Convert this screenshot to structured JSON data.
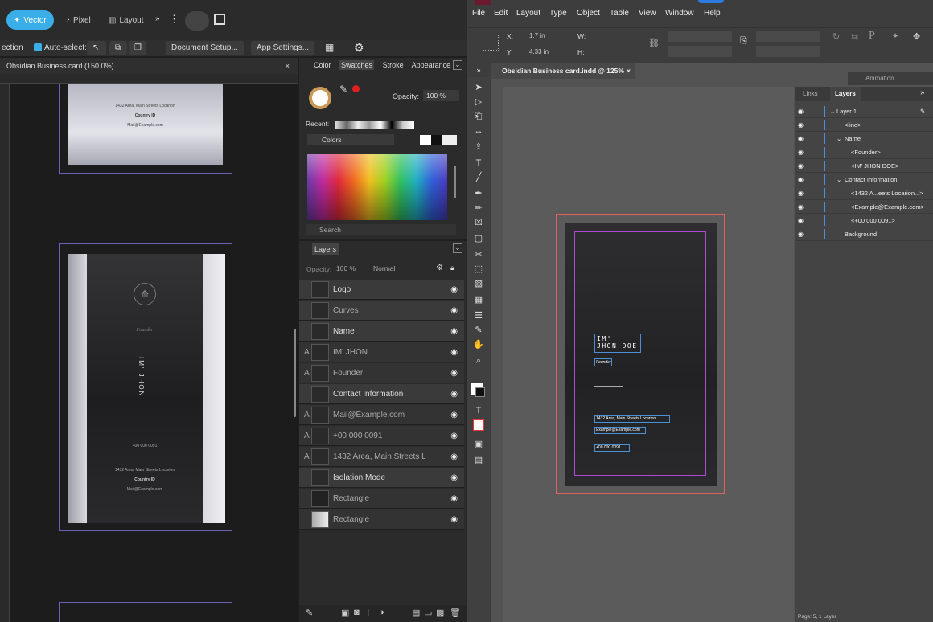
{
  "left_app": {
    "personas": [
      {
        "label": "Vector",
        "active": true
      },
      {
        "label": "Pixel"
      },
      {
        "label": "Layout"
      }
    ],
    "context": {
      "mode": "ection",
      "auto_select": "Auto-select:",
      "document_setup": "Document Setup...",
      "app_settings": "App Settings..."
    },
    "doc_tab": {
      "title": "Obsidian Business card (150.0%)",
      "close": "×"
    },
    "card_text": {
      "address": "1432 Area, Main Streets Locarion",
      "country": "Country ID",
      "email": "Mail@Example.com",
      "role": "Founder",
      "name": "IM' JHON",
      "phone": "+00 000 0091"
    },
    "swatches": {
      "tabs": [
        "Color",
        "Swatches",
        "Stroke",
        "Appearance"
      ],
      "opacity_label": "Opacity:",
      "opacity_value": "100 %",
      "recent_label": "Recent:",
      "palette": "Colors",
      "search_placeholder": "Search"
    },
    "layers": {
      "title": "Layers",
      "opacity_label": "Opacity:",
      "opacity_value": "100 %",
      "blend": "Normal",
      "rows": [
        {
          "name": "Logo",
          "type": ""
        },
        {
          "name": "Curves",
          "type": ""
        },
        {
          "name": "Name",
          "type": ""
        },
        {
          "name": "IM' JHON",
          "type": "A"
        },
        {
          "name": "Founder",
          "type": "A"
        },
        {
          "name": "Contact Information",
          "type": ""
        },
        {
          "name": "Mail@Example.com",
          "type": "A"
        },
        {
          "name": "+00 000 0091",
          "type": "A"
        },
        {
          "name": "1432 Area, Main Streets L",
          "type": "A"
        },
        {
          "name": "Isolation Mode",
          "type": ""
        },
        {
          "name": "Rectangle",
          "type": ""
        },
        {
          "name": "Rectangle",
          "type": ""
        }
      ]
    }
  },
  "right_app": {
    "menu": [
      "File",
      "Edit",
      "Layout",
      "Type",
      "Object",
      "Table",
      "View",
      "Window",
      "Help"
    ],
    "control": {
      "x_label": "X:",
      "x_value": "1.7 in",
      "y_label": "Y:",
      "y_value": "4.33 in",
      "w_label": "W:",
      "h_label": "H:"
    },
    "doc_tab": {
      "title": "Obsidian Business card.indd @ 125%",
      "close": "×"
    },
    "panel_header": "Animation",
    "card_text": {
      "name_line1": "IM'",
      "name_line2": "JHON DOE",
      "role": "Founder",
      "address": "1432 Area, Main Streets Locarion",
      "email": "Example@Example.com",
      "phone": "+00 000 0091"
    },
    "layers": {
      "tabs": [
        "Links",
        "Layers"
      ],
      "rows": [
        {
          "name": "Layer 1"
        },
        {
          "name": "<line>"
        },
        {
          "name": "Name"
        },
        {
          "name": "<Founder>"
        },
        {
          "name": "<IM' JHON DOE>"
        },
        {
          "name": "Contact Information"
        },
        {
          "name": "<1432 A...eets Locarion...>"
        },
        {
          "name": "<Example@Example.com>"
        },
        {
          "name": "<+00 000 0091>"
        },
        {
          "name": "Background"
        }
      ],
      "footer": "Page: 5, 1 Layer"
    }
  }
}
